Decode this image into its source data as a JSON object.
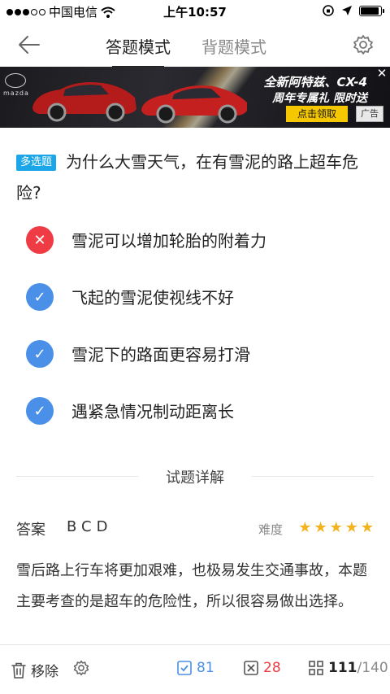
{
  "status_bar": {
    "carrier": "中国电信",
    "time": "上午10:57",
    "signal_dots_filled": 3,
    "signal_dots_total": 5,
    "battery_level_percent": 90
  },
  "nav": {
    "tabs": [
      {
        "label": "答题模式",
        "active": true
      },
      {
        "label": "背题模式",
        "active": false
      }
    ],
    "icons": {
      "back": "back-arrow-icon",
      "settings": "gear-icon"
    }
  },
  "ad": {
    "brand": "mazda",
    "title": "全新阿特兹、CX-4",
    "subtitle": "周年专属礼 限时送",
    "button": "点击领取",
    "tag": "广告",
    "close": "✕",
    "colors": {
      "button": "#f4c700",
      "car": "#b41b1b"
    }
  },
  "question": {
    "type": "多选题",
    "text": "为什么大雪天气，在有雪泥的路上超车危险?"
  },
  "options": [
    {
      "text": "雪泥可以增加轮胎的附着力",
      "status": "wrong",
      "icon": "✕"
    },
    {
      "text": "飞起的雪泥使视线不好",
      "status": "right",
      "icon": "✓"
    },
    {
      "text": "雪泥下的路面更容易打滑",
      "status": "right",
      "icon": "✓"
    },
    {
      "text": "遇紧急情况制动距离长",
      "status": "right",
      "icon": "✓"
    }
  ],
  "detail": {
    "title": "试题详解",
    "answer_label": "答案",
    "answer_value": "BCD",
    "difficulty_label": "难度",
    "difficulty_stars": 5,
    "explanation": "雪后路上行车将更加艰难，也极易发生交通事故，本题主要考查的是超车的危险性，所以很容易做出选择。"
  },
  "bottom_bar": {
    "remove_label": "移除",
    "correct_count": "81",
    "wrong_count": "28",
    "current": "111",
    "total": "/140",
    "colors": {
      "correct": "#4a90e8",
      "wrong": "#ee3b44"
    }
  }
}
